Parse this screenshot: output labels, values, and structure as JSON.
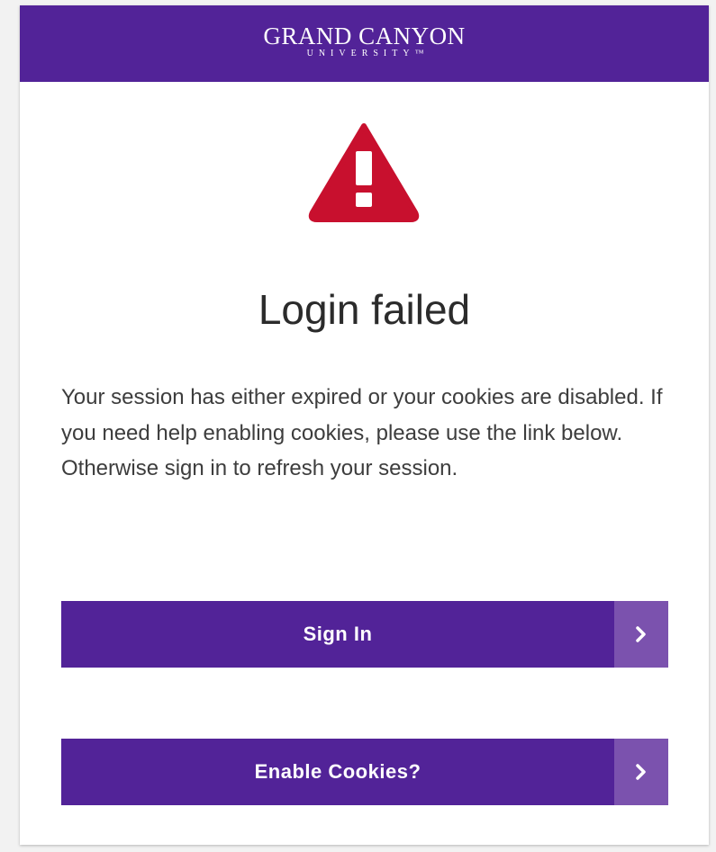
{
  "header": {
    "logo_main": "GRAND CANYON",
    "logo_sub": "UNIVERSITY™"
  },
  "alert": {
    "icon": "warning-triangle-icon",
    "icon_color": "#c8102e",
    "title": "Login failed",
    "message": "Your session has either expired or your cookies are disabled. If you need help enabling cookies, please use the link below. Otherwise sign in to refresh your session."
  },
  "buttons": {
    "sign_in_label": "Sign In",
    "enable_cookies_label": "Enable Cookies?",
    "arrow_icon": "chevron-right-icon"
  },
  "colors": {
    "brand_purple": "#522398",
    "arrow_panel": "#7b52ae"
  }
}
